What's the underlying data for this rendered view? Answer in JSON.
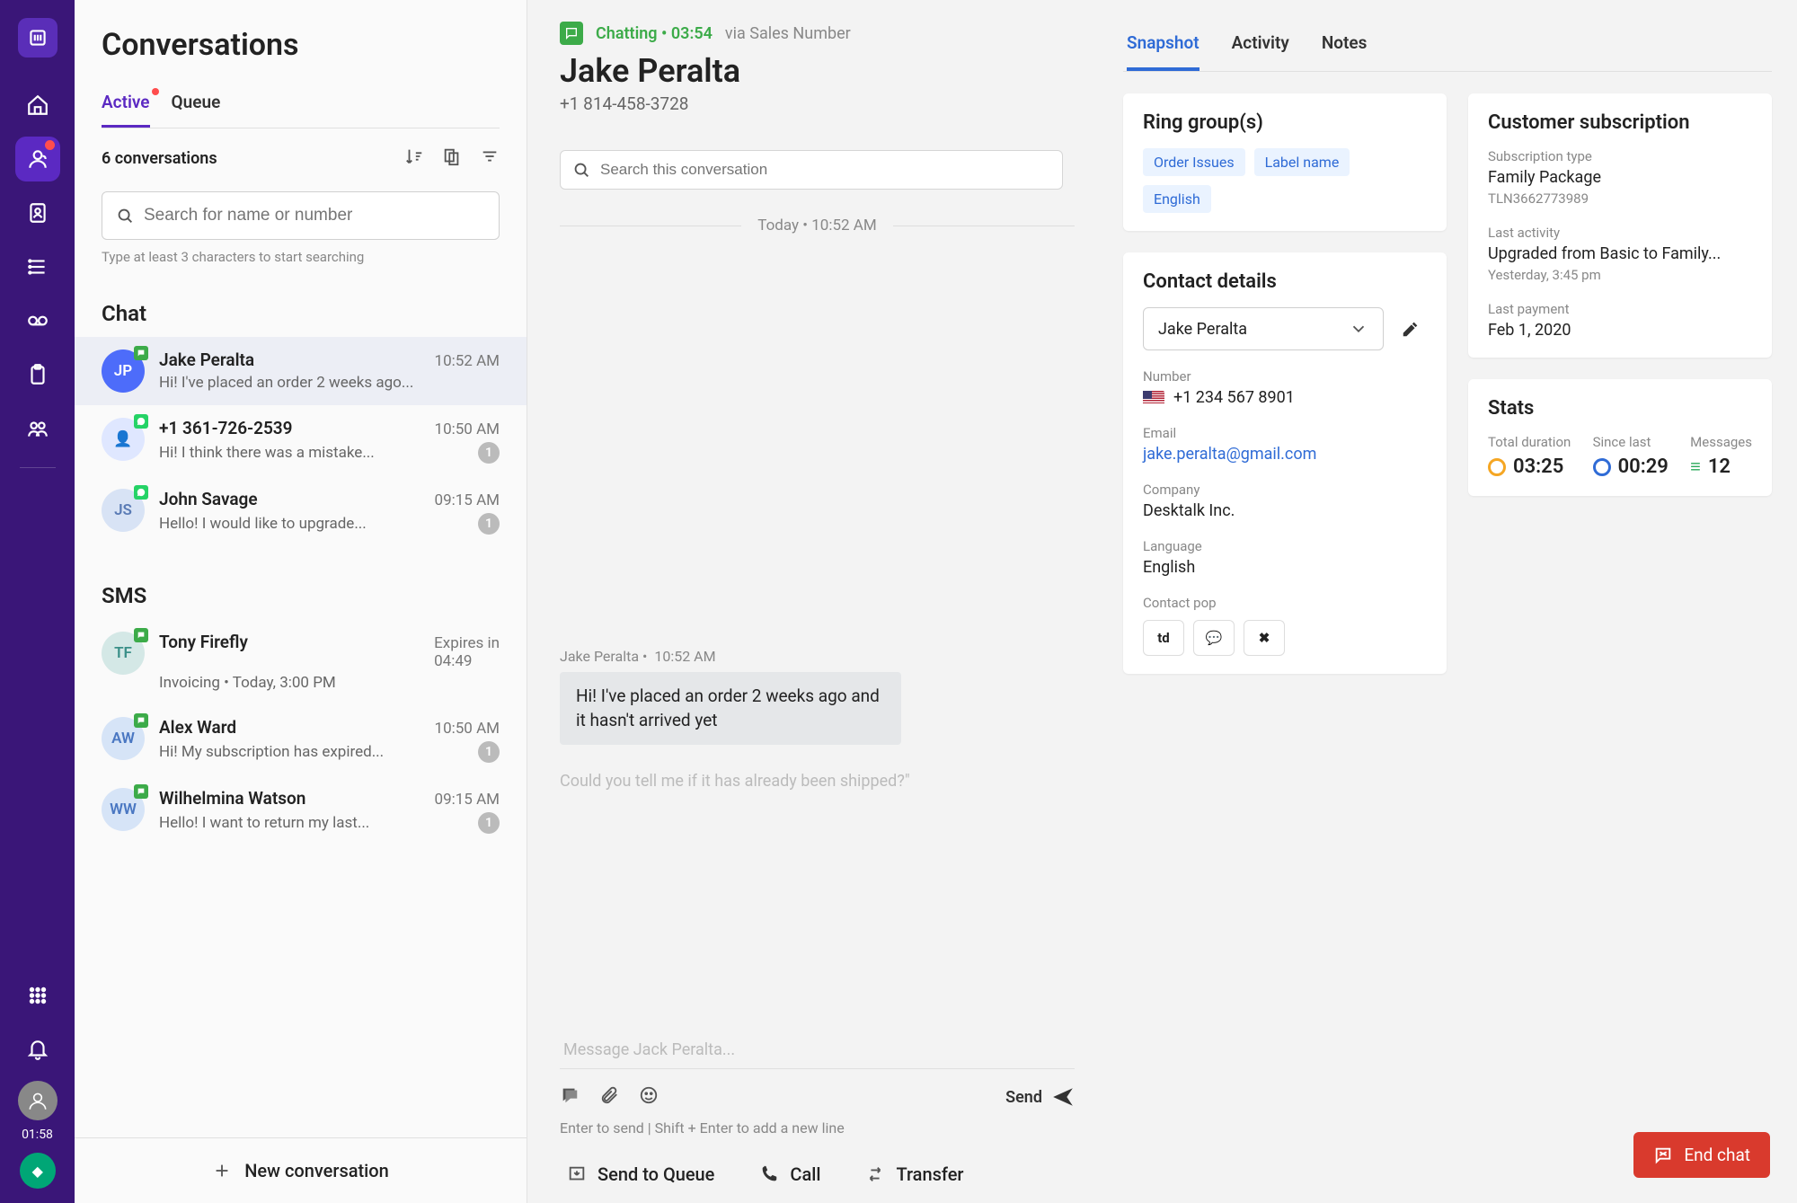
{
  "rail": {
    "timer": "01:58"
  },
  "sidepane": {
    "title": "Conversations",
    "tabs": {
      "active": "Active",
      "queue": "Queue"
    },
    "count": "6 conversations",
    "search_placeholder": "Search for name or number",
    "search_hint": "Type at least 3 characters to start searching",
    "chat_label": "Chat",
    "sms_label": "SMS",
    "chat": [
      {
        "initials": "JP",
        "color": "#4d6cfa",
        "name": "Jake Peralta",
        "time": "10:52 AM",
        "preview": "Hi! I've placed an order 2 weeks ago...",
        "badge": "",
        "channel": "chat"
      },
      {
        "initials": "👤",
        "color": "#dfe7ff",
        "textcolor": "#4d6cfa",
        "name": "+1 361-726-2539",
        "time": "10:50 AM",
        "preview": "Hi! I think there was a mistake...",
        "badge": "1",
        "channel": "whatsapp"
      },
      {
        "initials": "JS",
        "color": "#d8e3f5",
        "textcolor": "#5a7bb5",
        "name": "John Savage",
        "time": "09:15 AM",
        "preview": "Hello! I would like to upgrade...",
        "badge": "1",
        "channel": "whatsapp"
      }
    ],
    "sms": [
      {
        "initials": "TF",
        "color": "#d4e8e6",
        "textcolor": "#3a8f88",
        "name": "Tony Firefly",
        "time_label": "Expires in",
        "time": "04:49",
        "preview": "Invoicing • Today, 3:00 PM",
        "badge": "",
        "channel": "chat"
      },
      {
        "initials": "AW",
        "color": "#d6e4f7",
        "textcolor": "#4a77c2",
        "name": "Alex Ward",
        "time": "10:50 AM",
        "preview": "Hi! My subscription has expired...",
        "badge": "1",
        "channel": "chat"
      },
      {
        "initials": "WW",
        "color": "#d6e4f7",
        "textcolor": "#4a77c2",
        "name": "Wilhelmina Watson",
        "time": "09:15 AM",
        "preview": "Hello! I want to return my last...",
        "badge": "1",
        "channel": "chat"
      }
    ],
    "new_conv": "New conversation"
  },
  "chat": {
    "status": "Chatting • 03:54",
    "via": "via Sales Number",
    "contact_name": "Jake Peralta",
    "contact_phone": "+1 814-458-3728",
    "search_placeholder": "Search this conversation",
    "date_break": "Today • 10:52 AM",
    "msg_meta_sender": "Jake Peralta •",
    "msg_meta_time": "10:52 AM",
    "bubble": "Hi! I've placed an order 2 weeks ago and it hasn't arrived yet",
    "pending": "Could you tell me if it has already been shipped?\"",
    "compose_placeholder": "Message Jack Peralta...",
    "send": "Send",
    "compose_hint": "Enter to send | Shift + Enter to add a new line"
  },
  "foot": {
    "queue": "Send to Queue",
    "call": "Call",
    "transfer": "Transfer",
    "end": "End chat"
  },
  "info": {
    "tabs": {
      "snapshot": "Snapshot",
      "activity": "Activity",
      "notes": "Notes"
    },
    "ring": {
      "title": "Ring group(s)",
      "tags": [
        "Order Issues",
        "Label name",
        "English"
      ]
    },
    "contact": {
      "title": "Contact details",
      "name": "Jake Peralta",
      "number_k": "Number",
      "number_v": "+1 234 567 8901",
      "email_k": "Email",
      "email_v": "jake.peralta@gmail.com",
      "company_k": "Company",
      "company_v": "Desktalk Inc.",
      "language_k": "Language",
      "language_v": "English",
      "pop_k": "Contact pop",
      "pop": [
        "td",
        "💬",
        "✖"
      ]
    },
    "sub": {
      "title": "Customer subscription",
      "type_k": "Subscription type",
      "type_v": "Family Package",
      "type_note": "TLN3662773989",
      "act_k": "Last activity",
      "act_v": "Upgraded from Basic to Family...",
      "act_note": "Yesterday, 3:45 pm",
      "pay_k": "Last payment",
      "pay_v": "Feb 1, 2020"
    },
    "stats": {
      "title": "Stats",
      "total_k": "Total duration",
      "total_v": "03:25",
      "since_k": "Since last",
      "since_v": "00:29",
      "msg_k": "Messages",
      "msg_v": "12"
    }
  }
}
